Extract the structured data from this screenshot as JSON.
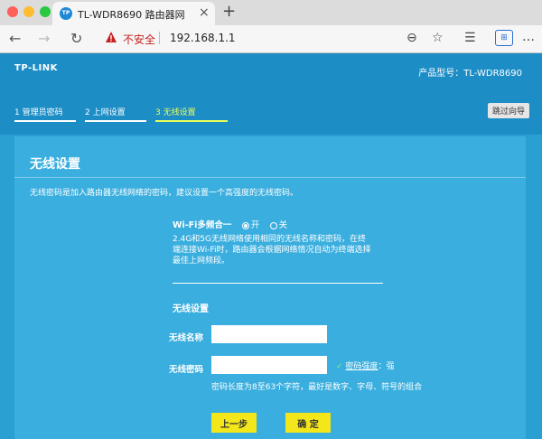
{
  "browser": {
    "tab_title": "TL-WDR8690 路由器网",
    "favicon_text": "TP",
    "url": "192.168.1.1",
    "insecure_label": "不安全",
    "ext_label": "⊞"
  },
  "router": {
    "logo": "TP-LINK",
    "model": "产品型号：TL-WDR8690",
    "steps": [
      {
        "label": "1 管理员密码"
      },
      {
        "label": "2 上网设置"
      },
      {
        "label": "3 无线设置"
      }
    ],
    "skip_label": "跳过向导"
  },
  "panel": {
    "title": "无线设置",
    "description": "无线密码是加入路由器无线网络的密码，建议设置一个高强度的无线密码。",
    "wifi_merge_label": "Wi-Fi多频合一",
    "wifi_merge_on": "开",
    "wifi_merge_off": "关",
    "wifi_merge_value": "开",
    "wifi_merge_note": "2.4G和5G无线网络使用相同的无线名称和密码，在终端连接Wi-Fi时，路由器会根据网络情况自动为终端选择最佳上网频段。",
    "section_title": "无线设置",
    "ssid_label": "无线名称",
    "ssid_value": "",
    "password_label": "无线密码",
    "password_value": "",
    "strength_link": "密码强度",
    "strength_value": "：强",
    "password_hint": "密码长度为8至63个字符，最好是数字、字母、符号的组合",
    "prev_button": "上一步",
    "ok_button": "确 定"
  },
  "colors": {
    "page_bg": "#2a9fd2",
    "panel_bg": "#3aaede",
    "button_yellow": "#f3e61a",
    "active_step": "#e8ff5a"
  }
}
